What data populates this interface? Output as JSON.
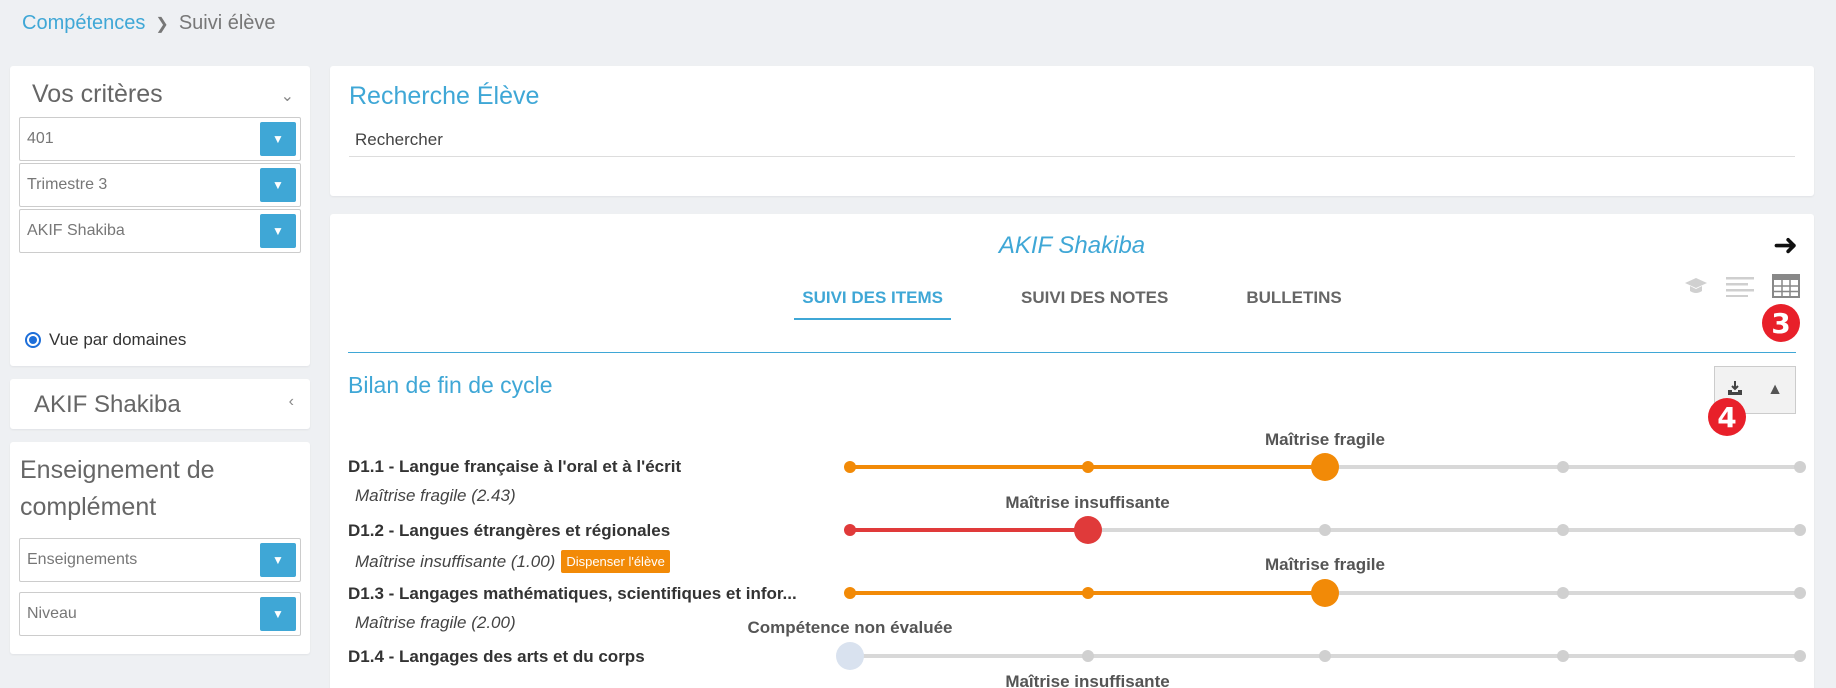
{
  "breadcrumb": {
    "root": "Compétences",
    "current": "Suivi élève"
  },
  "criteria": {
    "title": "Vos critères",
    "class_value": "401",
    "period_value": "Trimestre 3",
    "student_value": "AKIF Shakiba",
    "view_option": "Vue par domaines"
  },
  "student_card": {
    "name": "AKIF Shakiba"
  },
  "complement": {
    "title": "Enseignement de complément",
    "teaching_value": "Enseignements",
    "level_value": "Niveau"
  },
  "search": {
    "title": "Recherche Élève",
    "placeholder": "Rechercher"
  },
  "main": {
    "student_name": "AKIF Shakiba",
    "tabs": [
      {
        "label": "SUIVI DES ITEMS",
        "active": true
      },
      {
        "label": "SUIVI DES NOTES",
        "active": false
      },
      {
        "label": "BULLETINS",
        "active": false
      }
    ],
    "badges": {
      "view_badge": "3",
      "tool_badge": "4"
    },
    "section_title": "Bilan de fin de cycle",
    "domains": [
      {
        "label": "D1.1 - Langue française à l'oral et à l'écrit",
        "sub": "Maîtrise fragile (2.43)",
        "level_label": "Maîtrise fragile",
        "level": 3,
        "color": "#f28a07",
        "dispense": ""
      },
      {
        "label": "D1.2 - Langues étrangères et régionales",
        "sub": "Maîtrise insuffisante (1.00)",
        "level_label": "Maîtrise insuffisante",
        "level": 2,
        "color": "#e03a3a",
        "dispense": "Dispenser l'élève"
      },
      {
        "label": "D1.3 - Langages mathématiques, scientifiques et infor...",
        "sub": "Maîtrise fragile (2.00)",
        "level_label": "Maîtrise fragile",
        "level": 3,
        "color": "#f28a07",
        "dispense": ""
      },
      {
        "label": "D1.4 - Langages des arts et du corps",
        "sub": "",
        "level_label": "Compétence non évaluée",
        "level": 1,
        "color": "#d9e2ef",
        "dispense": ""
      },
      {
        "label": "",
        "sub": "",
        "level_label": "Maîtrise insuffisante",
        "level": 2,
        "color": "#e03a3a",
        "dispense": ""
      }
    ],
    "colors": {
      "accent": "#3fa7d6",
      "orange": "#f28a07",
      "red": "#e03a3a",
      "badge": "#e8202a"
    }
  }
}
